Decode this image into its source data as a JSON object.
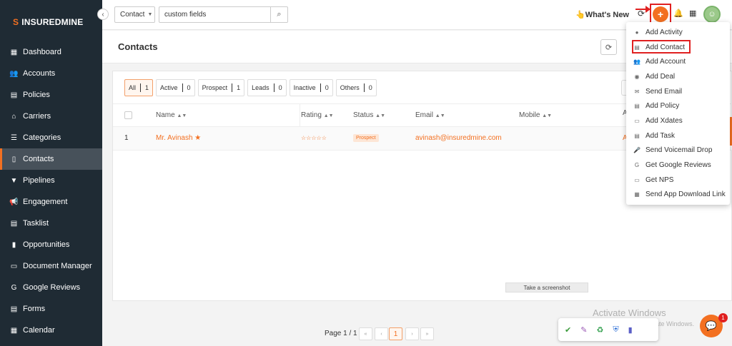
{
  "brand": {
    "name_bold": "INSUREDMINE",
    "mark": "S"
  },
  "sidebar": {
    "items": [
      {
        "label": "Dashboard",
        "icon": "▦"
      },
      {
        "label": "Accounts",
        "icon": "👥"
      },
      {
        "label": "Policies",
        "icon": "▤"
      },
      {
        "label": "Carriers",
        "icon": "⌂"
      },
      {
        "label": "Categories",
        "icon": "☰"
      },
      {
        "label": "Contacts",
        "icon": "▯"
      },
      {
        "label": "Pipelines",
        "icon": "▼"
      },
      {
        "label": "Engagement",
        "icon": "📢"
      },
      {
        "label": "Tasklist",
        "icon": "▤"
      },
      {
        "label": "Opportunities",
        "icon": "▮"
      },
      {
        "label": "Document Manager",
        "icon": "▭"
      },
      {
        "label": "Google Reviews",
        "icon": "G"
      },
      {
        "label": "Forms",
        "icon": "▤"
      },
      {
        "label": "Calendar",
        "icon": "▦"
      }
    ],
    "active": "Contacts"
  },
  "topbar": {
    "search_type": "Contact",
    "search_value": "custom fields",
    "whats_new": "What's New"
  },
  "page": {
    "title": "Contacts"
  },
  "filters": [
    {
      "label": "All",
      "count": "1"
    },
    {
      "label": "Active",
      "count": "0"
    },
    {
      "label": "Prospect",
      "count": "1"
    },
    {
      "label": "Leads",
      "count": "0"
    },
    {
      "label": "Inactive",
      "count": "0"
    },
    {
      "label": "Others",
      "count": "0"
    }
  ],
  "table": {
    "columns": [
      "Name",
      "Rating",
      "Status",
      "Email",
      "Mobile"
    ],
    "rows": [
      {
        "index": "1",
        "name": "Mr. Avinash",
        "rating": "☆☆☆☆☆",
        "status": "Prospect",
        "email": "avinash@insuredmine.com",
        "mobile": ""
      }
    ]
  },
  "menu": {
    "items": [
      {
        "label": "Add Activity",
        "icon": "●"
      },
      {
        "label": "Add Contact",
        "icon": "▤"
      },
      {
        "label": "Add Account",
        "icon": "👥"
      },
      {
        "label": "Add Deal",
        "icon": "◉"
      },
      {
        "label": "Send Email",
        "icon": "✉"
      },
      {
        "label": "Add Policy",
        "icon": "▤"
      },
      {
        "label": "Add Xdates",
        "icon": "▭"
      },
      {
        "label": "Add Task",
        "icon": "▤"
      },
      {
        "label": "Send Voicemail Drop",
        "icon": "🎤"
      },
      {
        "label": "Get Google Reviews",
        "icon": "G"
      },
      {
        "label": "Get NPS",
        "icon": "▭"
      },
      {
        "label": "Send App Download Link",
        "icon": "▦"
      }
    ]
  },
  "tooltip": {
    "screenshot": "Take a screenshot"
  },
  "pagination": {
    "label": "Page 1 / 1",
    "current": "1"
  },
  "windows": {
    "activate": "Activate Windows",
    "activate_sub": "Go to Settings to activate Windows."
  },
  "chat": {
    "badge": "1"
  },
  "colors": {
    "accent": "#f37021",
    "sidebar_bg": "#1f2b34",
    "highlight": "#e02020"
  }
}
